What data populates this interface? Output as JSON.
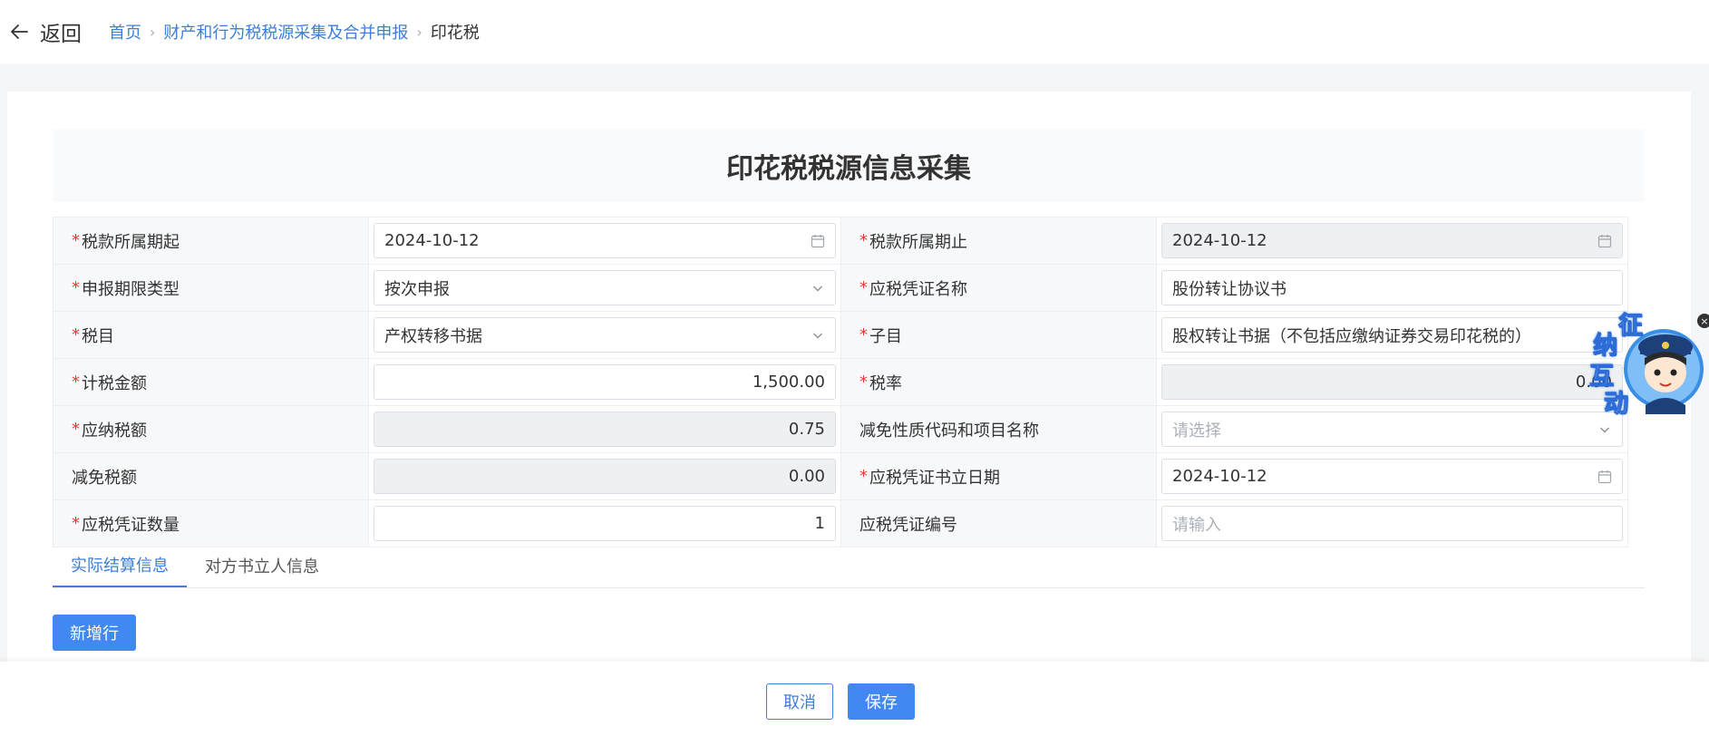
{
  "header": {
    "back_label": "返回",
    "breadcrumb": [
      "首页",
      "财产和行为税税源采集及合并申报",
      "印花税"
    ]
  },
  "form": {
    "title": "印花税税源信息采集",
    "rows": [
      {
        "left": {
          "label": "税款所属期起",
          "required": true,
          "value": "2024-10-12",
          "kind": "date"
        },
        "right": {
          "label": "税款所属期止",
          "required": true,
          "value": "2024-10-12",
          "kind": "date-disabled"
        }
      },
      {
        "left": {
          "label": "申报期限类型",
          "required": true,
          "value": "按次申报",
          "kind": "select"
        },
        "right": {
          "label": "应税凭证名称",
          "required": true,
          "value": "股份转让协议书",
          "kind": "text"
        }
      },
      {
        "left": {
          "label": "税目",
          "required": true,
          "value": "产权转移书据",
          "kind": "select"
        },
        "right": {
          "label": "子目",
          "required": true,
          "value": "股权转让书据（不包括应缴纳证券交易印花税的）",
          "kind": "text"
        }
      },
      {
        "left": {
          "label": "计税金额",
          "required": true,
          "value": "1,500.00",
          "kind": "number"
        },
        "right": {
          "label": "税率",
          "required": true,
          "value": "0.00",
          "kind": "number-disabled"
        }
      },
      {
        "left": {
          "label": "应纳税额",
          "required": true,
          "value": "0.75",
          "kind": "number-disabled"
        },
        "right": {
          "label": "减免性质代码和项目名称",
          "required": false,
          "placeholder": "请选择",
          "kind": "select-placeholder"
        }
      },
      {
        "left": {
          "label": "减免税额",
          "required": false,
          "value": "0.00",
          "kind": "number-disabled"
        },
        "right": {
          "label": "应税凭证书立日期",
          "required": true,
          "value": "2024-10-12",
          "kind": "date"
        }
      },
      {
        "left": {
          "label": "应税凭证数量",
          "required": true,
          "value": "1",
          "kind": "number"
        },
        "right": {
          "label": "应税凭证编号",
          "required": false,
          "placeholder": "请输入",
          "kind": "text-placeholder"
        }
      }
    ]
  },
  "tabs": [
    {
      "label": "实际结算信息",
      "active": true
    },
    {
      "label": "对方书立人信息",
      "active": false
    }
  ],
  "add_row_label": "新增行",
  "footer": {
    "cancel_label": "取消",
    "save_label": "保存"
  },
  "widget": {
    "chars": [
      "征",
      "纳",
      "互",
      "动"
    ]
  },
  "colors": {
    "accent": "#4189f0",
    "link": "#3d7fd8",
    "required": "#e53935"
  }
}
